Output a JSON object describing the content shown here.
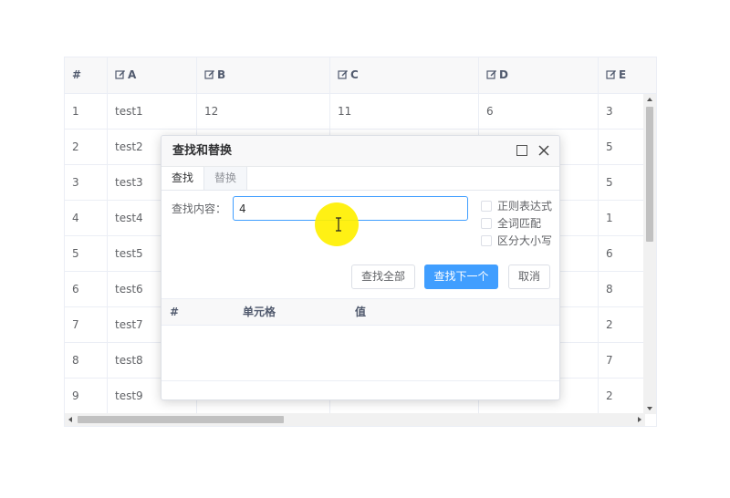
{
  "table": {
    "columns": [
      {
        "label": "#",
        "icon": false
      },
      {
        "label": "A",
        "icon": true
      },
      {
        "label": "B",
        "icon": true
      },
      {
        "label": "C",
        "icon": true
      },
      {
        "label": "D",
        "icon": true
      },
      {
        "label": "E",
        "icon": true
      }
    ],
    "rows": [
      [
        "1",
        "test1",
        "12",
        "11",
        "6",
        "3"
      ],
      [
        "2",
        "test2",
        "",
        "",
        "",
        "5"
      ],
      [
        "3",
        "test3",
        "",
        "",
        "",
        "5"
      ],
      [
        "4",
        "test4",
        "",
        "",
        "",
        "1"
      ],
      [
        "5",
        "test5",
        "",
        "",
        "",
        "6"
      ],
      [
        "6",
        "test6",
        "",
        "",
        "",
        "8"
      ],
      [
        "7",
        "test7",
        "",
        "",
        "",
        "2"
      ],
      [
        "8",
        "test8",
        "",
        "",
        "",
        "7"
      ],
      [
        "9",
        "test9",
        "",
        "",
        "",
        "2"
      ]
    ]
  },
  "dialog": {
    "title": "查找和替换",
    "tabs": [
      "查找",
      "替换"
    ],
    "find_label": "查找内容：",
    "find_value": "4",
    "options": [
      "正则表达式",
      "全词匹配",
      "区分大小写"
    ],
    "buttons": {
      "find_all": "查找全部",
      "find_next": "查找下一个",
      "cancel": "取消"
    },
    "result_columns": [
      "#",
      "单元格",
      "值"
    ]
  },
  "colors": {
    "primary": "#409eff",
    "border": "#ebeef5",
    "header_bg": "#f8f8f9",
    "cursor_highlight": "#fff000"
  }
}
